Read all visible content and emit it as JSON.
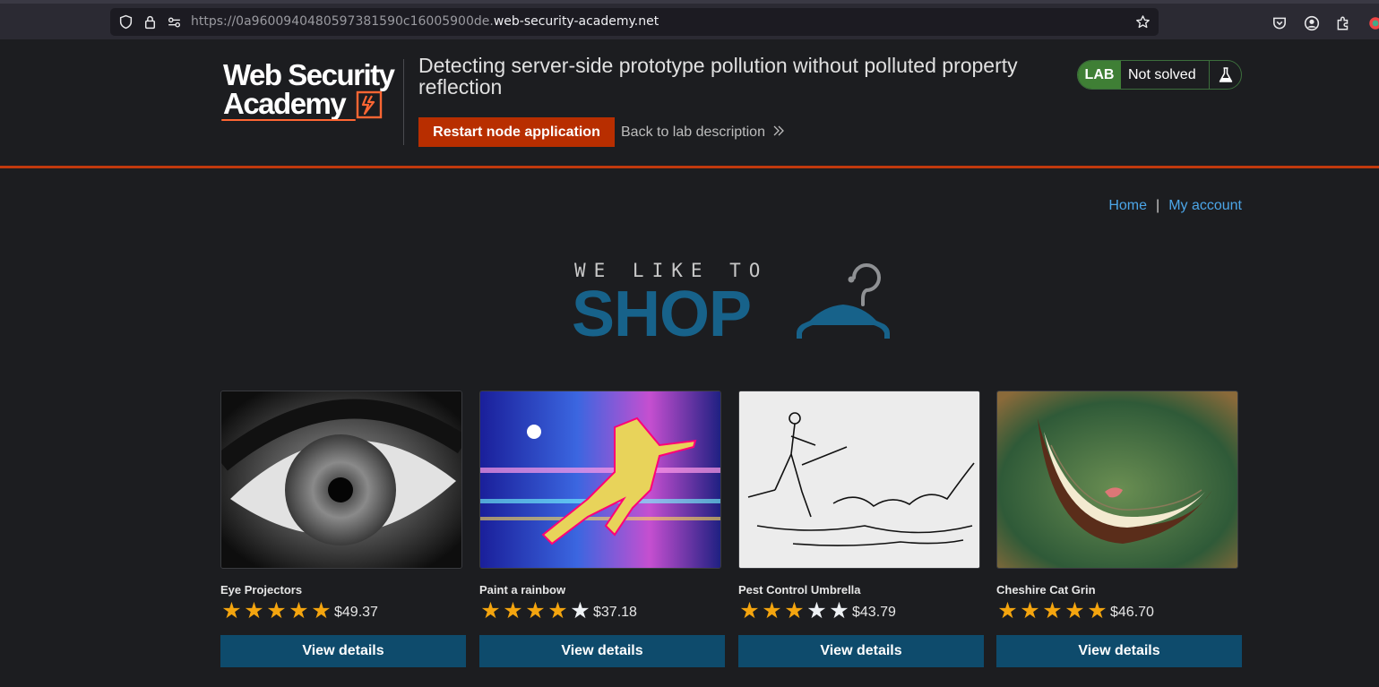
{
  "browser": {
    "url_prefix": "https://0a9600940480597381590c16005900de.",
    "url_host": "web-security-academy.net",
    "icons": [
      "shield-icon",
      "lock-icon",
      "permissions-icon",
      "bookmark-star-icon",
      "pocket-icon",
      "account-icon",
      "extensions-icon"
    ]
  },
  "header": {
    "logo_line1": "Web Security",
    "logo_line2": "Academy",
    "lab_title": "Detecting server-side prototype pollution without polluted property reflection",
    "restart_button": "Restart node application",
    "back_link": "Back to lab description",
    "back_link_icon": "»",
    "status_badge": "LAB",
    "status_text": "Not solved",
    "colors": {
      "accent": "#c1390d",
      "restart": "#b82e00",
      "lab_badge": "#3f7f35"
    }
  },
  "nav": {
    "home": "Home",
    "separator": "|",
    "account": "My account"
  },
  "banner": {
    "tagline": "WE LIKE TO",
    "shop": "SHOP",
    "color": "#17628a"
  },
  "products": [
    {
      "name": "Eye Projectors",
      "rating": 5,
      "price": "$49.37",
      "button": "View details",
      "image": "eye-image"
    },
    {
      "name": "Paint a rainbow",
      "rating": 4,
      "price": "$37.18",
      "button": "View details",
      "image": "rainbow-runner-image"
    },
    {
      "name": "Pest Control Umbrella",
      "rating": 3,
      "price": "$43.79",
      "button": "View details",
      "image": "umbrella-sketch-image"
    },
    {
      "name": "Cheshire Cat Grin",
      "rating": 5,
      "price": "$46.70",
      "button": "View details",
      "image": "cat-grin-image"
    }
  ]
}
